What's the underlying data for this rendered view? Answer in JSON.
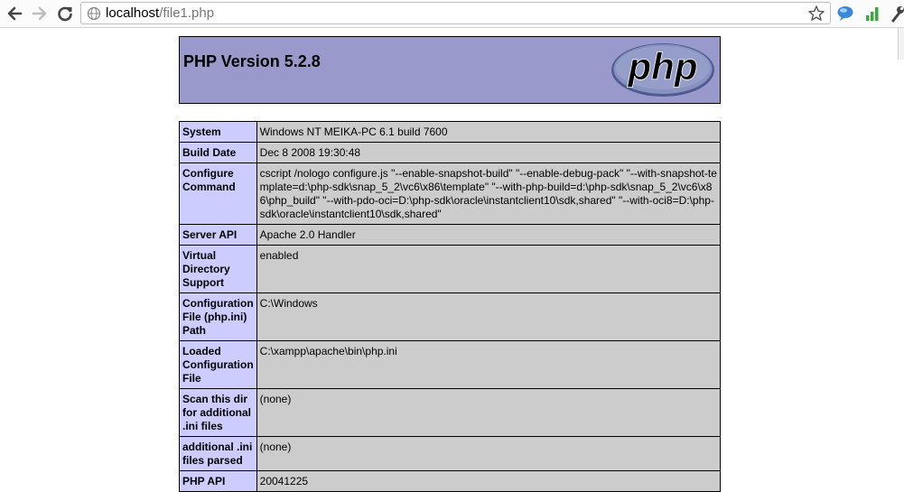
{
  "browser": {
    "url_host": "localhost",
    "url_path": "/file1.php"
  },
  "page": {
    "version_title": "PHP Version 5.2.8",
    "logo_text": "php",
    "logo_colors": {
      "fill": "#6c7eb7",
      "text": "#000000",
      "outline": "#000000"
    },
    "rows": [
      {
        "label": "System",
        "value": "Windows NT MEIKA-PC 6.1 build 7600"
      },
      {
        "label": "Build Date",
        "value": "Dec 8 2008 19:30:48"
      },
      {
        "label": "Configure Command",
        "value": "cscript /nologo configure.js \"--enable-snapshot-build\" \"--enable-debug-pack\" \"--with-snapshot-template=d:\\php-sdk\\snap_5_2\\vc6\\x86\\template\" \"--with-php-build=d:\\php-sdk\\snap_5_2\\vc6\\x86\\php_build\" \"--with-pdo-oci=D:\\php-sdk\\oracle\\instantclient10\\sdk,shared\" \"--with-oci8=D:\\php-sdk\\oracle\\instantclient10\\sdk,shared\""
      },
      {
        "label": "Server API",
        "value": "Apache 2.0 Handler"
      },
      {
        "label": "Virtual Directory Support",
        "value": "enabled"
      },
      {
        "label": "Configuration File (php.ini) Path",
        "value": "C:\\Windows"
      },
      {
        "label": "Loaded Configuration File",
        "value": "C:\\xampp\\apache\\bin\\php.ini"
      },
      {
        "label": "Scan this dir for additional .ini files",
        "value": "(none)"
      },
      {
        "label": "additional .ini files parsed",
        "value": "(none)"
      },
      {
        "label": "PHP API",
        "value": "20041225"
      }
    ]
  },
  "colors": {
    "header_bg": "#9999cc",
    "label_bg": "#ccccff",
    "value_bg": "#cccccc"
  },
  "icons": {
    "back": "back-arrow-icon",
    "forward": "forward-arrow-icon",
    "reload": "reload-icon",
    "page": "page-globe-icon",
    "bookmark": "star-icon",
    "ext1": "speech-bubble-icon",
    "ext2": "signal-bars-icon",
    "ext3": "wrench-icon"
  }
}
